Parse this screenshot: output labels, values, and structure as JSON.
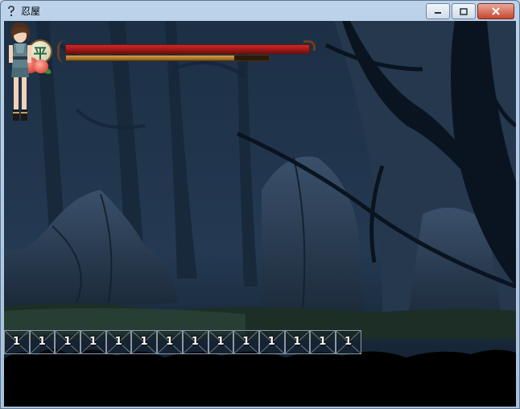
{
  "window": {
    "title": "忍屋",
    "icon": "help-question-icon",
    "buttons": {
      "minimize_icon": "minimize-icon",
      "maximize_icon": "maximize-icon",
      "close_icon": "close-icon"
    }
  },
  "hud": {
    "emblem_kanji": "平",
    "hp_fraction": 1.0,
    "sp_fraction": 0.83,
    "colors": {
      "hp": "#c02020",
      "sp": "#c08a38"
    }
  },
  "inventory": {
    "slots": [
      "1",
      "1",
      "1",
      "1",
      "1",
      "1",
      "1",
      "1",
      "1",
      "1",
      "1",
      "1",
      "1",
      "1"
    ]
  },
  "scene": {
    "setting": "dark forest at night",
    "character": "kunoichi girl standing"
  }
}
